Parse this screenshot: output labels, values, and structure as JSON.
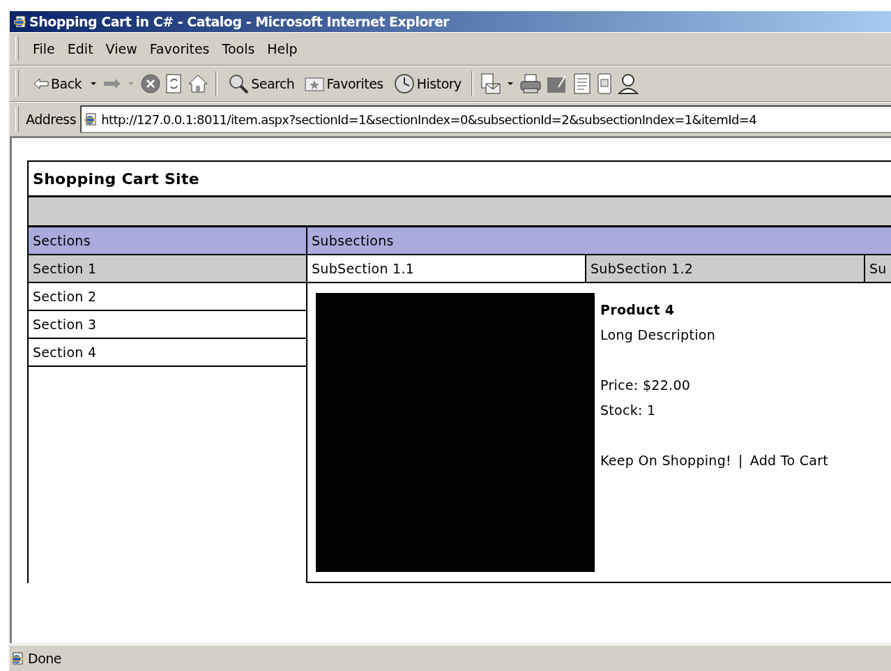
{
  "window": {
    "title": "Shopping Cart in C# - Catalog - Microsoft Internet Explorer"
  },
  "menu": [
    "File",
    "Edit",
    "View",
    "Favorites",
    "Tools",
    "Help"
  ],
  "toolbar": [
    {
      "kind": "back",
      "label": "Back"
    },
    {
      "kind": "caret"
    },
    {
      "kind": "forward"
    },
    {
      "kind": "caret_disabled"
    },
    {
      "kind": "stop"
    },
    {
      "kind": "refresh"
    },
    {
      "kind": "home"
    },
    {
      "kind": "separator"
    },
    {
      "kind": "search",
      "label": "Search"
    },
    {
      "kind": "favorites",
      "label": "Favorites"
    },
    {
      "kind": "history",
      "label": "History"
    },
    {
      "kind": "separator"
    },
    {
      "kind": "mail"
    },
    {
      "kind": "caret"
    },
    {
      "kind": "print"
    },
    {
      "kind": "edit"
    },
    {
      "kind": "discuss"
    },
    {
      "kind": "messenger"
    },
    {
      "kind": "person"
    }
  ],
  "address": {
    "label": "Address",
    "value": "http://127.0.0.1:8011/item.aspx?sectionId=1&sectionIndex=0&subsectionId=2&subsectionIndex=1&itemId=4"
  },
  "page": {
    "site_title": "Shopping Cart Site",
    "sections": {
      "header": "Sections",
      "items": [
        {
          "label": "Section 1",
          "selected": true
        },
        {
          "label": "Section 2",
          "selected": false
        },
        {
          "label": "Section 3",
          "selected": false
        },
        {
          "label": "Section 4",
          "selected": false
        }
      ]
    },
    "subsections": {
      "header": "Subsections",
      "items": [
        {
          "label": "SubSection 1.1",
          "selected": false
        },
        {
          "label": "SubSection 1.2",
          "selected": true
        },
        {
          "label": "Su",
          "selected": true
        }
      ]
    },
    "product": {
      "name": "Product 4",
      "description": "Long Description",
      "price": "Price: $22.00",
      "stock": "Stock: 1",
      "links": [
        {
          "label": "Keep On Shopping!"
        },
        {
          "label": "Add To Cart"
        }
      ],
      "separator": "|"
    }
  },
  "status_bar": {
    "text": "Done"
  }
}
